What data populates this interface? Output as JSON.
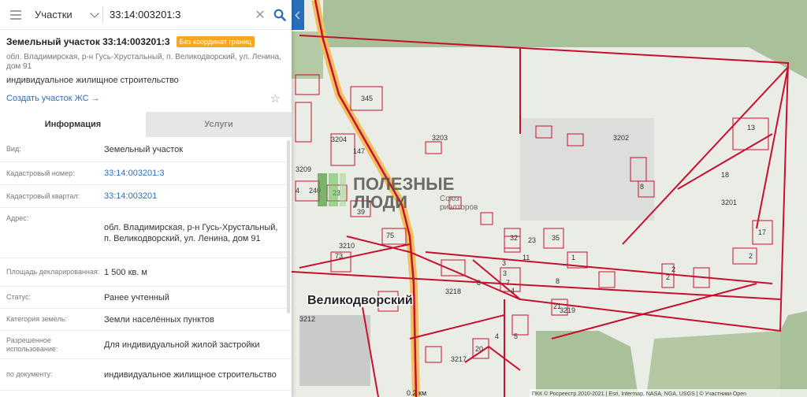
{
  "search": {
    "category": "Участки",
    "query": "33:14:003201:3"
  },
  "parcel": {
    "title": "Земельный участок 33:14:003201:3",
    "badge": "Без координат границ",
    "address": "обл. Владимирская, р-н Гусь-Хрустальный, п. Великодворский, ул. Ленина, дом 91",
    "usage": "индивидуальное жилищное строительство",
    "create_link": "Создать участок ЖС →"
  },
  "tabs": [
    {
      "label": "Информация",
      "active": true
    },
    {
      "label": "Услуги",
      "active": false
    }
  ],
  "info_rows": [
    {
      "key": "Вид:",
      "value": "Земельный участок"
    },
    {
      "key": "Кадастровый номер:",
      "value": "33:14:003201:3"
    },
    {
      "key": "Кадастровый квартал:",
      "value": "33:14:003201"
    },
    {
      "key": "Адрес:",
      "value": "обл. Владимирская, р-н Гусь-Хрустальный, п. Великодворский, ул. Ленина, дом 91"
    },
    {
      "key": "Площадь декларированная:",
      "value": "1 500 кв. м"
    },
    {
      "key": "Статус:",
      "value": "Ранее учтенный"
    },
    {
      "key": "Категория земель:",
      "value": "Земли населённых пунктов"
    },
    {
      "key": "Разрешенное использование:",
      "value": "Для индивидуальной жилой застройки"
    },
    {
      "key": "по документу:",
      "value": "индивидуальное жилищное строительство"
    }
  ],
  "map": {
    "town_label": "Великодворский",
    "watermark_line1": "ПОЛЕЗНЫЕ",
    "watermark_line2": "ЛЮДИ",
    "watermark_sub1": "Союз",
    "watermark_sub2": "риэлторов",
    "scale": "0.2 км",
    "attribution": "ПКК © Росреестр 2010-2021 | Esri, Intermap, NASA, NGA, USGS | © Участники Open",
    "parcel_labels": [
      "345",
      "3203",
      "3202",
      "3204",
      "147",
      "3209",
      "240",
      "4",
      "23",
      "39",
      "18",
      "13",
      "3201",
      "17",
      "2",
      "75",
      "32",
      "35",
      "23",
      "11",
      "3",
      "7",
      "4",
      "3218",
      "8",
      "3210",
      "73",
      "3212",
      "3219",
      "21",
      "3217",
      "20",
      "5",
      "4",
      "8",
      "2",
      "2",
      "3",
      "8",
      "1",
      "8"
    ]
  },
  "colors": {
    "accent": "#2a6ebb",
    "badge": "#f5a623",
    "parcel_line": "#c8102e"
  }
}
